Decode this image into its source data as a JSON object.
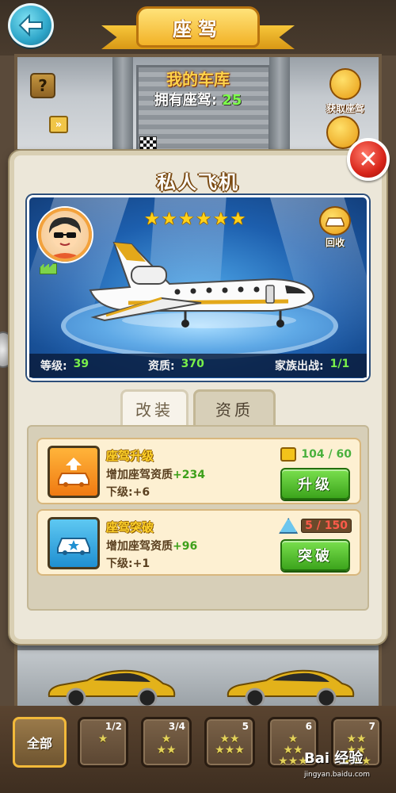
{
  "header": {
    "title": "座驾"
  },
  "garage": {
    "title": "我的车库",
    "owned_label": "拥有座驾:",
    "owned_count": "25",
    "acquire_label": "获取座驾",
    "help_label": "?",
    "arrows_label": "»"
  },
  "modal": {
    "title": "私人飞机",
    "stars": 6,
    "recycle_label": "回收",
    "stats": {
      "level_label": "等级:",
      "level_value": "39",
      "quality_label": "资质:",
      "quality_value": "370",
      "family_label": "家族出战:",
      "family_value": "1/1"
    },
    "tabs": [
      {
        "label": "改装",
        "active": false
      },
      {
        "label": "资质",
        "active": true
      }
    ],
    "cards": [
      {
        "title": "座驾升级",
        "desc_prefix": "增加座驾资质",
        "desc_value": "+234",
        "next_prefix": "下级:",
        "next_value": "+6",
        "resource": "104 / 60",
        "action": "升级"
      },
      {
        "title": "座驾突破",
        "desc_prefix": "增加座驾资质",
        "desc_value": "+96",
        "next_prefix": "下级:",
        "next_value": "+1",
        "resource": "5 / 150",
        "action": "突破"
      }
    ]
  },
  "filters": [
    {
      "label": "全部"
    },
    {
      "label": "1/2",
      "stars": 1
    },
    {
      "label": "3/4",
      "stars": 3
    },
    {
      "label": "5",
      "stars": 5
    },
    {
      "label": "6",
      "stars": 6
    },
    {
      "label": "7",
      "stars": 7
    }
  ],
  "watermark": {
    "text": "Bai 经验",
    "url": "jingyan.baidu.com"
  },
  "colors": {
    "accent_gold": "#f2b227",
    "success_green": "#3ca41c",
    "value_green": "#79f04a",
    "close_red": "#d8251a"
  }
}
